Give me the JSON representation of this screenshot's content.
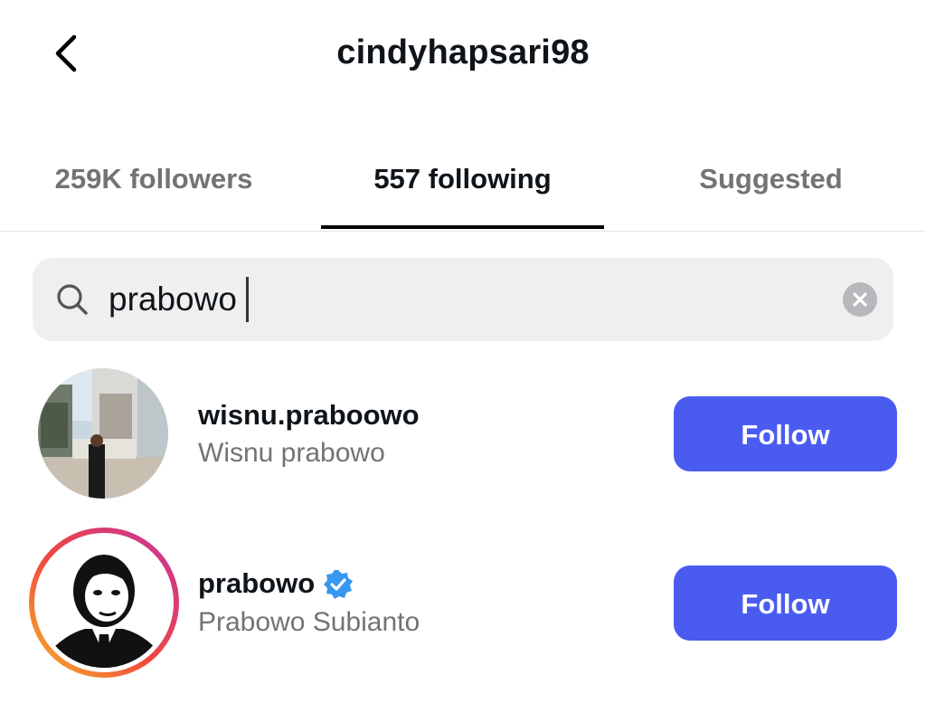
{
  "header": {
    "title": "cindyhapsari98",
    "back_icon": "chevron-left-icon"
  },
  "tabs": [
    {
      "label": "259K followers",
      "active": false
    },
    {
      "label": "557 following",
      "active": true
    },
    {
      "label": "Suggested",
      "active": false
    }
  ],
  "search": {
    "value": "prabowo",
    "search_icon": "search-icon",
    "clear_icon": "clear-icon"
  },
  "results": [
    {
      "handle": "wisnu.praboowo",
      "name": "Wisnu prabowo",
      "verified": false,
      "story_ring": false,
      "follow_label": "Follow"
    },
    {
      "handle": "prabowo",
      "name": "Prabowo Subianto",
      "verified": true,
      "story_ring": true,
      "follow_label": "Follow"
    }
  ],
  "colors": {
    "follow_button": "#4a5cf0",
    "verified_badge": "#3897f0",
    "secondary_text": "#737373",
    "search_bg": "#efeff0"
  }
}
